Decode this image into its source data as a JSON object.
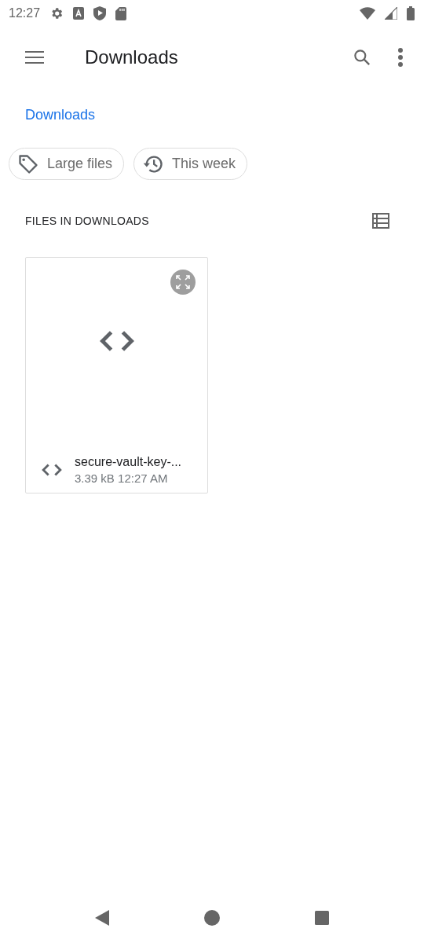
{
  "status_bar": {
    "time": "12:27"
  },
  "toolbar": {
    "title": "Downloads"
  },
  "breadcrumb": "Downloads",
  "chips": [
    {
      "label": "Large files",
      "kind": "tag"
    },
    {
      "label": "This week",
      "kind": "history"
    }
  ],
  "section": {
    "title": "FILES IN DOWNLOADS"
  },
  "files": [
    {
      "name": "secure-vault-key-...",
      "details": "3.39 kB 12:27 AM"
    }
  ]
}
